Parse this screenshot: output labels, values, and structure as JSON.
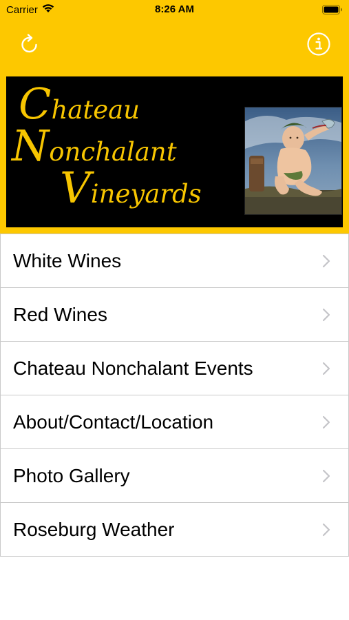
{
  "status_bar": {
    "carrier": "Carrier",
    "time": "8:26 AM"
  },
  "nav": {
    "refresh_icon": "refresh-icon",
    "info_icon": "info-icon"
  },
  "banner": {
    "line1_cap": "C",
    "line1_rest": "hateau",
    "line2_cap": "N",
    "line2_rest": "onchalant",
    "line3_cap": "V",
    "line3_rest": "ineyards"
  },
  "menu": {
    "items": [
      {
        "label": "White Wines"
      },
      {
        "label": "Red Wines"
      },
      {
        "label": "Chateau Nonchalant Events"
      },
      {
        "label": "About/Contact/Location"
      },
      {
        "label": "Photo Gallery"
      },
      {
        "label": "Roseburg Weather"
      }
    ]
  },
  "colors": {
    "brand_yellow": "#fdc800",
    "banner_text": "#f7c500",
    "separator": "#c9c9c9",
    "chevron": "#c4c4c8"
  }
}
